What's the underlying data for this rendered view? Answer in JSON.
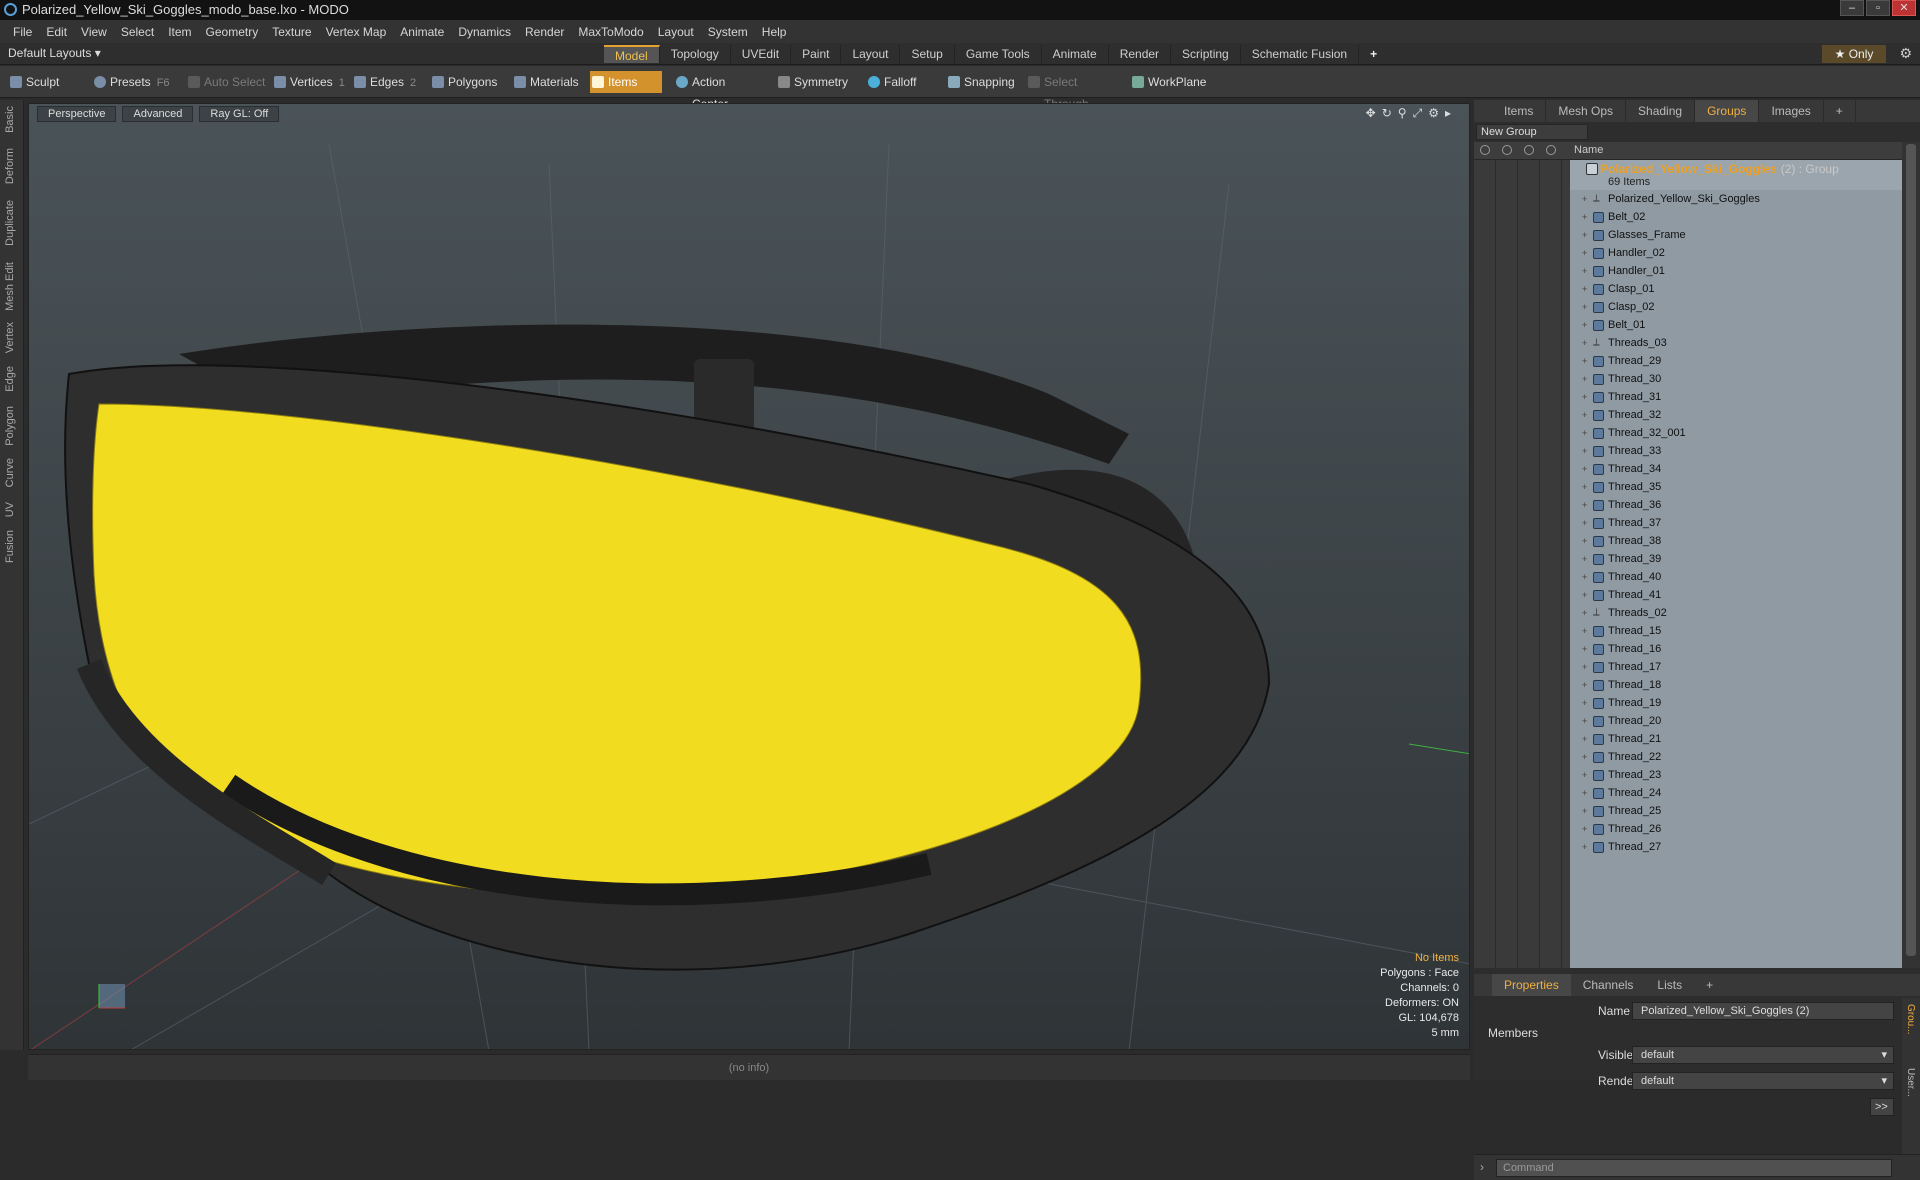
{
  "window": {
    "title": "Polarized_Yellow_Ski_Goggles_modo_base.lxo - MODO"
  },
  "menu": [
    "File",
    "Edit",
    "View",
    "Select",
    "Item",
    "Geometry",
    "Texture",
    "Vertex Map",
    "Animate",
    "Dynamics",
    "Render",
    "MaxToModo",
    "Layout",
    "System",
    "Help"
  ],
  "layout_bar": {
    "layout_name": "Default Layouts ▾",
    "tabs": [
      "Model",
      "Topology",
      "UVEdit",
      "Paint",
      "Layout",
      "Setup",
      "Game Tools",
      "Animate",
      "Render",
      "Scripting",
      "Schematic Fusion"
    ],
    "active_tab": "Model",
    "plus": "+",
    "only": "★ Only"
  },
  "toolbar": {
    "sculpt": "Sculpt",
    "presets": "Presets",
    "presets_key": "F6",
    "auto_select": "Auto Select",
    "vertices": "Vertices",
    "vertices_key": "1",
    "edges": "Edges",
    "edges_key": "2",
    "polygons": "Polygons",
    "materials": "Materials",
    "items": "Items",
    "action_center": "Action Center",
    "symmetry": "Symmetry",
    "falloff": "Falloff",
    "snapping": "Snapping",
    "select_through": "Select Through",
    "workplane": "WorkPlane"
  },
  "left_tabs": [
    "Basic",
    "Deform",
    "Duplicate",
    "Mesh Edit",
    "Vertex",
    "Edge",
    "Polygon",
    "Curve",
    "UV",
    "Fusion"
  ],
  "viewport": {
    "perspective": "Perspective",
    "advanced": "Advanced",
    "raygl": "Ray GL: Off",
    "stats": {
      "items": "No Items",
      "polygons": "Polygons : Face",
      "channels": "Channels: 0",
      "deformers": "Deformers: ON",
      "gl": "GL: 104,678",
      "scale": "5 mm"
    },
    "lens_color": "#f2dc20"
  },
  "status": {
    "info": "(no info)"
  },
  "panel": {
    "tabs": [
      "Items",
      "Mesh Ops",
      "Shading",
      "Groups",
      "Images"
    ],
    "active_tab": "Groups",
    "new_group": "New Group",
    "name_col": "Name",
    "group": {
      "name": "Polarized_Yellow_Ski_Goggles",
      "meta": "(2) : Group",
      "count": "69 Items"
    },
    "items": [
      {
        "name": "Polarized_Yellow_Ski_Goggles",
        "type": "locator"
      },
      {
        "name": "Belt_02",
        "type": "mesh"
      },
      {
        "name": "Glasses_Frame",
        "type": "mesh"
      },
      {
        "name": "Handler_02",
        "type": "mesh"
      },
      {
        "name": "Handler_01",
        "type": "mesh"
      },
      {
        "name": "Clasp_01",
        "type": "mesh"
      },
      {
        "name": "Clasp_02",
        "type": "mesh"
      },
      {
        "name": "Belt_01",
        "type": "mesh"
      },
      {
        "name": "Threads_03",
        "type": "locator"
      },
      {
        "name": "Thread_29",
        "type": "mesh"
      },
      {
        "name": "Thread_30",
        "type": "mesh"
      },
      {
        "name": "Thread_31",
        "type": "mesh"
      },
      {
        "name": "Thread_32",
        "type": "mesh"
      },
      {
        "name": "Thread_32_001",
        "type": "mesh"
      },
      {
        "name": "Thread_33",
        "type": "mesh"
      },
      {
        "name": "Thread_34",
        "type": "mesh"
      },
      {
        "name": "Thread_35",
        "type": "mesh"
      },
      {
        "name": "Thread_36",
        "type": "mesh"
      },
      {
        "name": "Thread_37",
        "type": "mesh"
      },
      {
        "name": "Thread_38",
        "type": "mesh"
      },
      {
        "name": "Thread_39",
        "type": "mesh"
      },
      {
        "name": "Thread_40",
        "type": "mesh"
      },
      {
        "name": "Thread_41",
        "type": "mesh"
      },
      {
        "name": "Threads_02",
        "type": "locator"
      },
      {
        "name": "Thread_15",
        "type": "mesh"
      },
      {
        "name": "Thread_16",
        "type": "mesh"
      },
      {
        "name": "Thread_17",
        "type": "mesh"
      },
      {
        "name": "Thread_18",
        "type": "mesh"
      },
      {
        "name": "Thread_19",
        "type": "mesh"
      },
      {
        "name": "Thread_20",
        "type": "mesh"
      },
      {
        "name": "Thread_21",
        "type": "mesh"
      },
      {
        "name": "Thread_22",
        "type": "mesh"
      },
      {
        "name": "Thread_23",
        "type": "mesh"
      },
      {
        "name": "Thread_24",
        "type": "mesh"
      },
      {
        "name": "Thread_25",
        "type": "mesh"
      },
      {
        "name": "Thread_26",
        "type": "mesh"
      },
      {
        "name": "Thread_27",
        "type": "mesh"
      }
    ]
  },
  "properties": {
    "tabs": [
      "Properties",
      "Channels",
      "Lists"
    ],
    "active_tab": "Properties",
    "name_label": "Name",
    "name_value": "Polarized_Yellow_Ski_Goggles (2)",
    "members": "Members",
    "visible_label": "Visible",
    "visible_value": "default",
    "render_label": "Render",
    "render_value": "default",
    "more": ">>",
    "side_tabs": [
      "Grou...",
      "User..."
    ]
  },
  "command": {
    "placeholder": "Command"
  }
}
